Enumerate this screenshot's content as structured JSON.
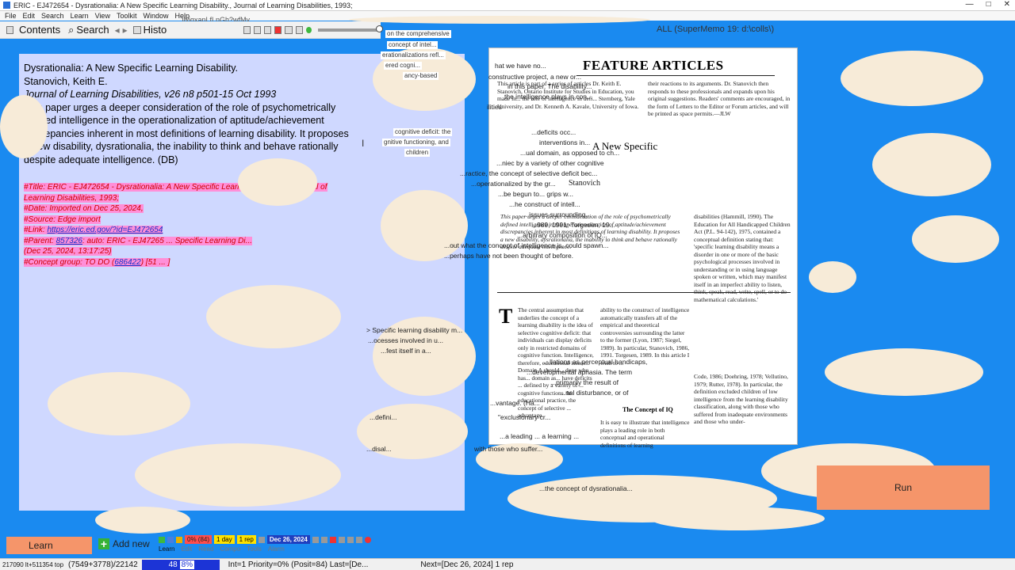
{
  "window": {
    "title": "ERIC - EJ472654 - Dysrationalia: A New Specific Learning Disability., Journal of Learning Disabilities, 1993;",
    "controls": [
      "—",
      "□",
      "✕"
    ]
  },
  "menu": {
    "items": [
      "File",
      "Edit",
      "Search",
      "Learn",
      "View",
      "Toolkit",
      "Window",
      "Help"
    ]
  },
  "url_ghost": "...ilvigxanLfLnGh?wfMy",
  "toolbar": {
    "contents_label": "Contents",
    "search_label": "Search",
    "history_label": "Histo",
    "collection": "ALL (SuperMemo 19: d:\\colls\\)"
  },
  "article": {
    "title": "Dysrationalia: A New Specific Learning Disability.",
    "author": "Stanovich, Keith E.",
    "journal": "Journal of Learning Disabilities, v26 n8 p501-15 Oct 1993",
    "abstract": "This paper urges a deeper consideration of the role of psychometrically defined intelligence in the operationalization of aptitude/achievement discrepancies inherent in most definitions of learning disability. It proposes a new disability, dysrationalia, the inability to think and behave rationally despite adequate intelligence. (DB)"
  },
  "references": {
    "title": "#Title: ERIC - EJ472654 - Dysrationalia: A New Specific Learning Disability., Journal of Learning Disabilities, 1993;",
    "date": "#Date: Imported on Dec 25, 2024,",
    "source": "#Source: Edge import",
    "link_label": "#Link: ",
    "link_url": "https://eric.ed.gov/?id=EJ472654",
    "parent_label": "#Parent: ",
    "parent_id": "857326",
    "parent_rest": ": auto: ERIC - EJ47265 ... Specific Learning Di...",
    "parent_date": "(Dec 25, 2024, 13:17:25)",
    "concept_label": "#Concept group: TO DO (",
    "concept_id": "686422",
    "concept_rest": ") [51 ... ]"
  },
  "doc_image": {
    "header": "FEATURE ARTICLES",
    "article_title": "A New Specific",
    "author": "Stanovich",
    "section": "The Concept of IQ",
    "intro": "This article is part of a series of articles Dr. Keith E. Stanovich, Ontario Institute for Studies in Education, you made in... the role of intelligence in defi... Sternberg, Yale University, and Dr. Kenneth A. Kavale, University of Iowa.",
    "editor_note": "their reactions to its arguments. Dr. Stanovich then responds to these professionals and expands upon his original suggestions. Readers' comments are encouraged, in the form of Letters to the Editor or Forum articles, and will be printed as space permits.—JLW",
    "abstract_text": "This paper urges a deeper consideration of the role of psychometrically defined intelligence in the operationalization of aptitude/achievement discrepancies inherent in most definitions of learning disability. It proposes a new disability, dysrationalia, the inability to think and behave rationally despite adequate intelligence.",
    "col1": "The central assumption that underlies the concept of a learning disability is the idea of selective cognitive deficit: that individuals can display deficits only in restricted domains of cognitive function. Intelligence, therefore, educational issues... Domain A should... done who has... domain as... have deficits ... defined by a variety of ... cognitive functions. In educational practice, the concept of selective ... advantage.",
    "col2": "ability to the construct of intelligence automatically transfers all of the empirical and theoretical controversies surrounding the latter to the former (Lyon, 1987; Siegel, 1989). In particular, Stanovich, 1986, 1991. Torgesen, 1989. In this article I wish to ... ",
    "col3": "disabilities (Hammill, 1990). The Education for All Handicapped Children Act (P.L. 94-142), 1975, contained a conceptual definition stating that: 'specific learning disability means a disorder in one or more of the basic psychological processes involved in understanding or in using language spoken or written, which may manifest itself in an imperfect ability to listen, think, speak, read, write, spell, or to do mathematical calculations.'",
    "col3b": "Code, 1986; Doehring, 1978; Vellutino, 1979; Rutter, 1978). In particular, the definition excluded children of low intelligence from the learning disability classification, along with those who suffered from inadequate environments and those who under-",
    "section_text": "It is easy to illustrate that intelligence plays a leading role in both conceptual and operational definitions of learning"
  },
  "overlay_snippets": {
    "s1": "on the comprehensive",
    "s2": "concept of intel...",
    "s3": "erationalizations refl...",
    "s4": "ered cogni...",
    "s5": "ancy-based",
    "s6": "cognitive deficit: the",
    "s7": "gnitive functioning, and",
    "s8": "children",
    "s9": "hat we have no...",
    "s10": "constructive project, a new or...",
    "s11": "in this paper. The disability...",
    "s12": "the intelligence plays in con...",
    "s13": "ilities",
    "s14": "...deficits occ...",
    "s15": "interventions in...",
    "s16": "...ual domain, as opposed to ch...",
    "s17": "...niec by a variety of other cognitive",
    "s18": "...ractice, the concept of selective deficit bec...",
    "s19": "...operationalized by the gr...",
    "s20": "...be begun to... grips w...",
    "s21": "...he construct of intell...",
    "s22": "...issues surrounding...",
    "s23": "...989, 1991; Torgesen, 19...",
    "s24": "...arbitrary composition of IQ...",
    "s25": "...out what the concept of intelligence is, could spawn...",
    "s26": "...perhaps have not been thought of before.",
    "s27": "> Specific learning disability m...",
    "s28": "...ocesses involved in u...",
    "s29": "...fest itself in a...",
    "s30": "...llations as perceptual handicaps,",
    "s31": "...developmental aphasia. The term",
    "s32": "...primarily the result of",
    "s33": "...nal disturbance, or of",
    "s34": "...vantage. (Ha...",
    "s35": "\"exclusionary cr...",
    "s36": "...a leading ... a learning ...",
    "s37": "with those who suffer...",
    "s38": "...the concept of dysrationalia...",
    "s39": "...defini...",
    "s40": "...disal..."
  },
  "run_button": {
    "label": "Run"
  },
  "learn_button": {
    "label": "Learn"
  },
  "add_new_button": {
    "label": "Add new"
  },
  "stats": {
    "pct": "0% (84)",
    "interval": "1 day",
    "reps": "1 rep",
    "date": "Dec 26, 2024"
  },
  "bottom_tabs": [
    "Learn",
    "Edit",
    "Read",
    "Compo",
    "Tools",
    "Alarm"
  ],
  "statusbar": {
    "element": "217090 lt+511354 top",
    "counts": "(7549+3778)/22142",
    "progress_value": "48",
    "progress_pct": "8%",
    "interval_info": "Int=1 Priority=0% (Posit=84) Last=[De...",
    "next": "Next=[Dec 26, 2024] 1 rep"
  }
}
